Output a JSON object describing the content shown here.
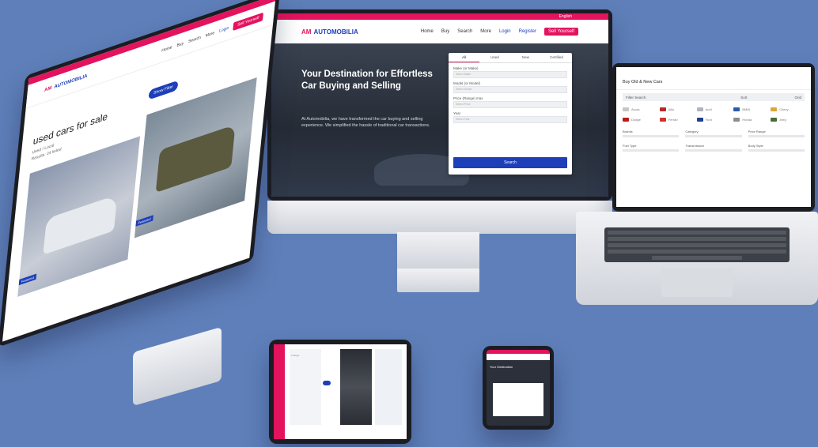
{
  "brand": {
    "name": "AUTOMOBILIA",
    "mark": "AM",
    "colors": {
      "accent": "#e3135e",
      "primary": "#1d3fb8",
      "background": "#5f7fba"
    }
  },
  "main_screen": {
    "top_bar": {
      "language": "English"
    },
    "nav": {
      "items": [
        "Home",
        "Buy",
        "Search",
        "More"
      ],
      "login": "Login",
      "register": "Register",
      "cta": "Sell Yourself"
    },
    "hero": {
      "title": "Your Destination for Effortless Car Buying and Selling",
      "text": "At Automobilia, we have transformed the car buying and selling experience. We simplified the hassle of traditional car transactions."
    },
    "search_form": {
      "tabs": [
        "All",
        "Used",
        "New",
        "Certified"
      ],
      "fields": [
        {
          "label": "Make (or Make)",
          "placeholder": "Select Make"
        },
        {
          "label": "Model (or Model)",
          "placeholder": "Select Model"
        },
        {
          "label": "Price (Range) max",
          "placeholder": "Select Price"
        },
        {
          "label": "Year",
          "placeholder": "Select Year"
        }
      ],
      "button": "Search"
    }
  },
  "left_screen": {
    "nav": {
      "items": [
        "Home",
        "Buy",
        "Search",
        "More"
      ],
      "login": "Login",
      "register": "Register",
      "cta": "Sell Yourself"
    },
    "page_title": "used cars for sale",
    "sub_a": "Used / Local",
    "sub_b": "Results: 24 listed",
    "filter_button": "Show Filter",
    "card_tags": [
      "Featured",
      "Featured"
    ]
  },
  "laptop_screen": {
    "heading": "Buy Old & New Cars",
    "filter": {
      "label": "Filter Search",
      "sort": "Sort",
      "view": "Grid"
    },
    "brands": [
      {
        "name": "Acura",
        "color": "#c6c6c6"
      },
      {
        "name": "Alfa",
        "color": "#b5282b"
      },
      {
        "name": "Audi",
        "color": "#b0b3ba"
      },
      {
        "name": "BMW",
        "color": "#2a5aa9"
      },
      {
        "name": "Chevy",
        "color": "#d8a63a"
      },
      {
        "name": "Dodge",
        "color": "#b71c1c"
      },
      {
        "name": "Ferrari",
        "color": "#d32f2f"
      },
      {
        "name": "Ford",
        "color": "#1f3f8f"
      },
      {
        "name": "Honda",
        "color": "#8c8c8c"
      },
      {
        "name": "Jeep",
        "color": "#4c6a3a"
      }
    ],
    "rows": [
      "Brands",
      "Category",
      "Price Range",
      "Fuel Type",
      "Transmission",
      "Body Style"
    ]
  },
  "tablet_screen": {
    "label": "Listings"
  },
  "phone_screen": {
    "label": "Your Destination"
  }
}
